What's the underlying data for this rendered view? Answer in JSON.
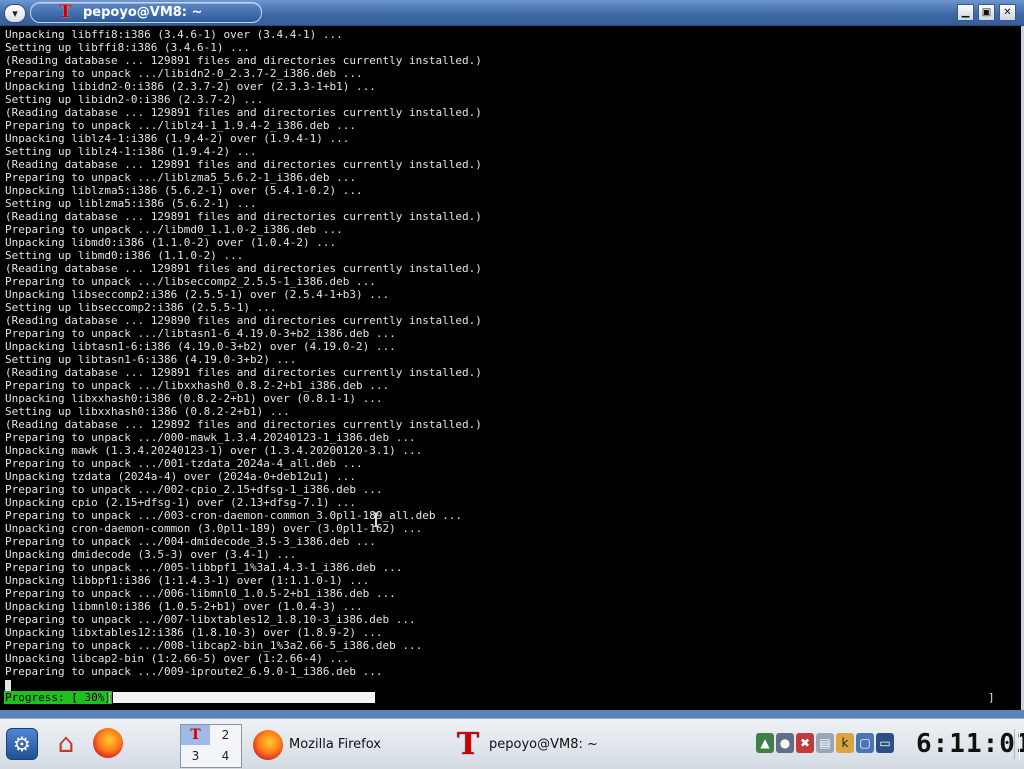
{
  "window": {
    "title": "pepoyo@VM8: ~",
    "logo_glyph": "T",
    "menu_glyph": "▾",
    "minimize_glyph": "▁",
    "maximize_glyph": "▣",
    "close_glyph": "✕"
  },
  "terminal": {
    "lines": [
      "Unpacking libffi8:i386 (3.4.6-1) over (3.4.4-1) ...",
      "Setting up libffi8:i386 (3.4.6-1) ...",
      "(Reading database ... 129891 files and directories currently installed.)",
      "Preparing to unpack .../libidn2-0_2.3.7-2_i386.deb ...",
      "Unpacking libidn2-0:i386 (2.3.7-2) over (2.3.3-1+b1) ...",
      "Setting up libidn2-0:i386 (2.3.7-2) ...",
      "(Reading database ... 129891 files and directories currently installed.)",
      "Preparing to unpack .../liblz4-1_1.9.4-2_i386.deb ...",
      "Unpacking liblz4-1:i386 (1.9.4-2) over (1.9.4-1) ...",
      "Setting up liblz4-1:i386 (1.9.4-2) ...",
      "(Reading database ... 129891 files and directories currently installed.)",
      "Preparing to unpack .../liblzma5_5.6.2-1_i386.deb ...",
      "Unpacking liblzma5:i386 (5.6.2-1) over (5.4.1-0.2) ...",
      "Setting up liblzma5:i386 (5.6.2-1) ...",
      "(Reading database ... 129891 files and directories currently installed.)",
      "Preparing to unpack .../libmd0_1.1.0-2_i386.deb ...",
      "Unpacking libmd0:i386 (1.1.0-2) over (1.0.4-2) ...",
      "Setting up libmd0:i386 (1.1.0-2) ...",
      "(Reading database ... 129891 files and directories currently installed.)",
      "Preparing to unpack .../libseccomp2_2.5.5-1_i386.deb ...",
      "Unpacking libseccomp2:i386 (2.5.5-1) over (2.5.4-1+b3) ...",
      "Setting up libseccomp2:i386 (2.5.5-1) ...",
      "(Reading database ... 129890 files and directories currently installed.)",
      "Preparing to unpack .../libtasn1-6_4.19.0-3+b2_i386.deb ...",
      "Unpacking libtasn1-6:i386 (4.19.0-3+b2) over (4.19.0-2) ...",
      "Setting up libtasn1-6:i386 (4.19.0-3+b2) ...",
      "(Reading database ... 129891 files and directories currently installed.)",
      "Preparing to unpack .../libxxhash0_0.8.2-2+b1_i386.deb ...",
      "Unpacking libxxhash0:i386 (0.8.2-2+b1) over (0.8.1-1) ...",
      "Setting up libxxhash0:i386 (0.8.2-2+b1) ...",
      "(Reading database ... 129892 files and directories currently installed.)",
      "Preparing to unpack .../000-mawk_1.3.4.20240123-1_i386.deb ...",
      "Unpacking mawk (1.3.4.20240123-1) over (1.3.4.20200120-3.1) ...",
      "Preparing to unpack .../001-tzdata_2024a-4_all.deb ...",
      "Unpacking tzdata (2024a-4) over (2024a-0+deb12u1) ...",
      "Preparing to unpack .../002-cpio_2.15+dfsg-1_i386.deb ...",
      "Unpacking cpio (2.15+dfsg-1) over (2.13+dfsg-7.1) ...",
      "Preparing to unpack .../003-cron-daemon-common_3.0pl1-189_all.deb ...",
      "Unpacking cron-daemon-common (3.0pl1-189) over (3.0pl1-162) ...",
      "Preparing to unpack .../004-dmidecode_3.5-3_i386.deb ...",
      "Unpacking dmidecode (3.5-3) over (3.4-1) ...",
      "Preparing to unpack .../005-libbpf1_1%3a1.4.3-1_i386.deb ...",
      "Unpacking libbpf1:i386 (1:1.4.3-1) over (1:1.1.0-1) ...",
      "Preparing to unpack .../006-libmnl0_1.0.5-2+b1_i386.deb ...",
      "Unpacking libmnl0:i386 (1.0.5-2+b1) over (1.0.4-3) ...",
      "Preparing to unpack .../007-libxtables12_1.8.10-3_i386.deb ...",
      "Unpacking libxtables12:i386 (1.8.10-3) over (1.8.9-2) ...",
      "Preparing to unpack .../008-libcap2-bin_1%3a2.66-5_i386.deb ...",
      "Unpacking libcap2-bin (1:2.66-5) over (1:2.66-4) ...",
      "Preparing to unpack .../009-iproute2_6.9.0-1_i386.deb ..."
    ],
    "progress_label": "Progress: [ 30%]",
    "progress_percent": 30,
    "progress_open": "[",
    "progress_close": "]"
  },
  "taskbar": {
    "kmenu_glyph": "⚙",
    "home_glyph": "⌂",
    "pager": {
      "desktop1_glyph": "T",
      "desktop2": "2",
      "desktop3": "3",
      "desktop4": "4"
    },
    "tasks": [
      {
        "label": "Mozilla Firefox",
        "icon": "firefox-icon"
      },
      {
        "label": "pepoyo@VM8: ~",
        "icon": "terminal-icon",
        "glyph": "T"
      }
    ],
    "tray_icons": [
      "network-icon",
      "user-icon",
      "security-icon",
      "clipboard-icon",
      "k-icon",
      "window-icon",
      "display-icon"
    ],
    "clock": "6:11:01"
  },
  "colors": {
    "title_bar": "#3e6aa6",
    "terminal_bg": "#000000",
    "terminal_fg": "#e4e4e4",
    "progress_label_bg": "#1fbf1f",
    "taskbar_bg": "#d4dbe3",
    "desktop": "#5b82b9"
  }
}
